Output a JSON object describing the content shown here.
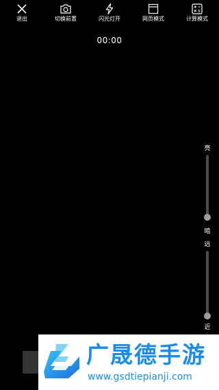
{
  "toolbar": {
    "items": [
      {
        "label": "退出",
        "icon": "close-icon"
      },
      {
        "label": "切换前置",
        "icon": "camera-switch-icon"
      },
      {
        "label": "闪光灯开",
        "icon": "flash-icon"
      },
      {
        "label": "网页模式",
        "icon": "browser-window-icon"
      },
      {
        "label": "计算模式",
        "icon": "calculator-icon"
      }
    ]
  },
  "timer": "00:00",
  "brightness": {
    "top_label": "亮",
    "bottom_label": "暗",
    "level": 0.0
  },
  "zoom": {
    "top_label": "远",
    "bottom_label": "近",
    "level": 0.0
  },
  "watermark": {
    "brand": "广晟德手游",
    "url": "www.gsdtiepianji.com",
    "colors": {
      "text": "#1a8cf0",
      "logo_primary": "#1e6fe0",
      "logo_accent": "#33c1f5"
    }
  }
}
